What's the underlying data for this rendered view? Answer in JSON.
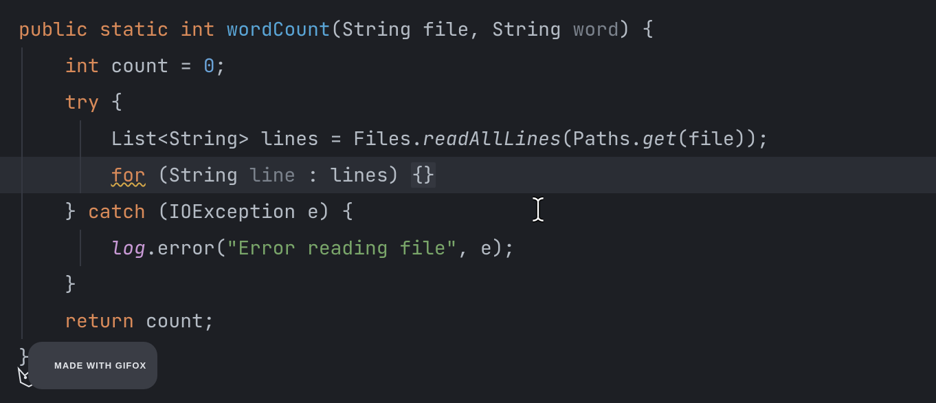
{
  "colors": {
    "background": "#1d1f24",
    "highlight": "#2a2d34",
    "keyword": "#d98b5a",
    "function": "#5aa5d6",
    "string": "#7aa66a",
    "number": "#6aa2d6",
    "muted": "#7b828c"
  },
  "code": {
    "line1": {
      "public": "public",
      "static": "static",
      "int": "int",
      "fn": "wordCount",
      "lp": "(",
      "t1": "String ",
      "p1": "file",
      "c1": ", ",
      "t2": "String ",
      "p2": "word",
      "rp": ") {"
    },
    "line2": {
      "indent": "    ",
      "int": "int",
      "sp": " ",
      "var": "count = ",
      "num": "0",
      "semi": ";"
    },
    "line3": {
      "indent": "    ",
      "try": "try",
      "brace": " {"
    },
    "line4": {
      "indent": "        ",
      "type": "List<String> ",
      "var": "lines = Files.",
      "m1": "readAllLines",
      "lp": "(Paths.",
      "m2": "get",
      "args": "(file));"
    },
    "line5": {
      "indent": "        ",
      "for": "for",
      "sp": " (String ",
      "line": "line",
      "rest": " : lines) ",
      "braces": "{}"
    },
    "line6": {
      "indent": "    } ",
      "catch": "catch",
      "args": " (IOException e) {"
    },
    "line7": {
      "indent": "        ",
      "log": "log",
      "call": ".error(",
      "str": "\"Error reading file\"",
      "rest": ", e);"
    },
    "line8": {
      "indent": "    }"
    },
    "line9": {
      "indent": "    ",
      "return": "return",
      "rest": " count;"
    },
    "line10": {
      "brace": "}"
    }
  },
  "badge": {
    "text": "MADE WITH GIFOX"
  },
  "cursor_icon": "text-cursor-icon"
}
